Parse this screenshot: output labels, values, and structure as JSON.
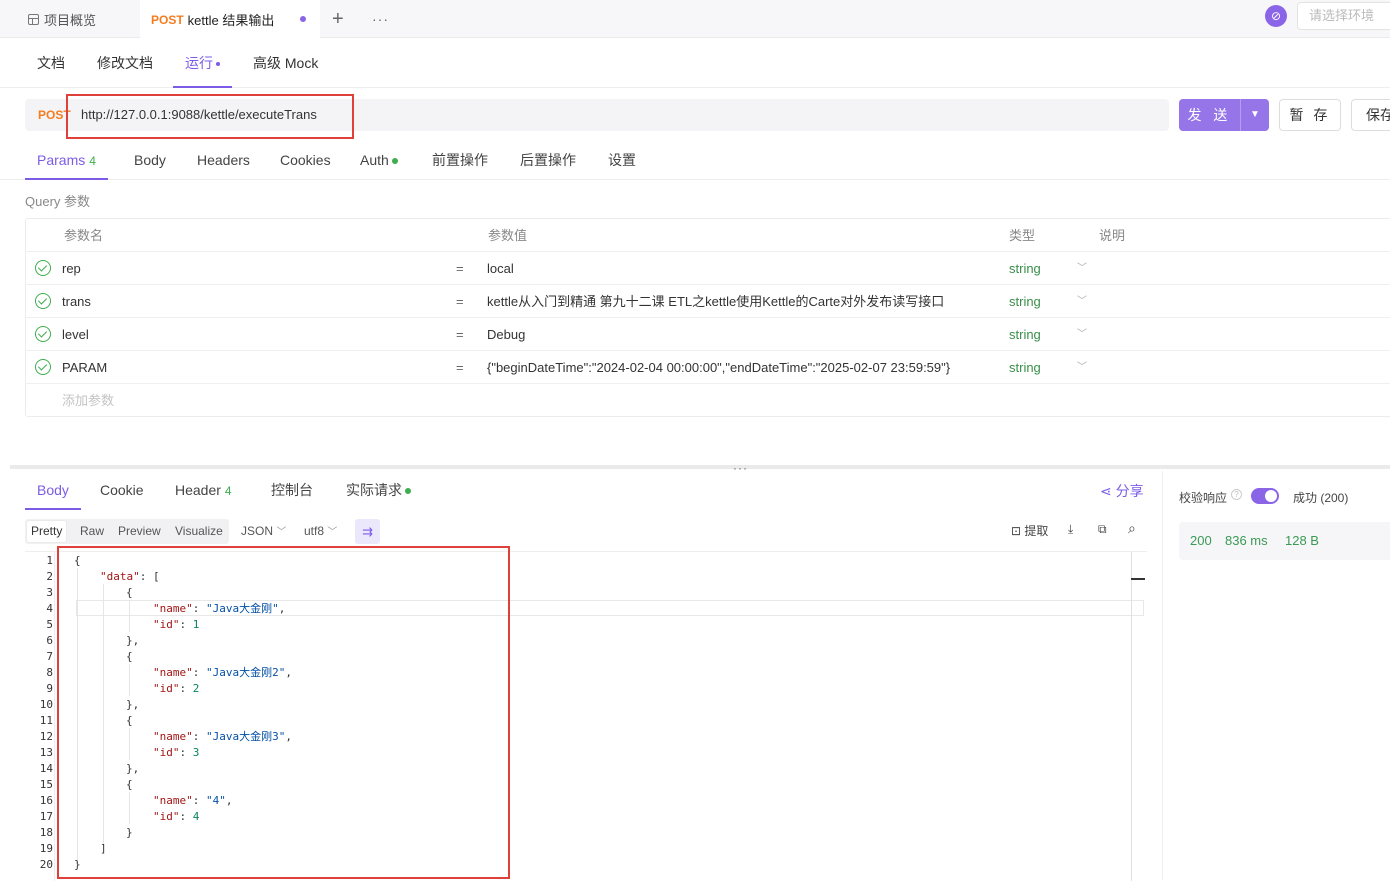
{
  "top_tabs": {
    "overview_label": "项目概览",
    "active_method": "POST",
    "active_title": "kettle 结果输出",
    "plus": "+",
    "more": "···",
    "env_placeholder": "请选择环境"
  },
  "doc_tabs": [
    "文档",
    "修改文档",
    "运行",
    "高级 Mock"
  ],
  "request": {
    "method": "POST",
    "url": "http://127.0.0.1:9088/kettle/executeTrans",
    "send_label": "发 送",
    "temp_save_label": "暂 存",
    "save_label": "保存"
  },
  "param_tabs": {
    "params": "Params",
    "params_count": "4",
    "body": "Body",
    "headers": "Headers",
    "cookies": "Cookies",
    "auth": "Auth",
    "pre": "前置操作",
    "post": "后置操作",
    "settings": "设置"
  },
  "query_label": "Query 参数",
  "params_table": {
    "headers": {
      "name": "参数名",
      "value": "参数值",
      "type": "类型",
      "desc": "说明"
    },
    "rows": [
      {
        "name": "rep",
        "value": "local",
        "type": "string"
      },
      {
        "name": "trans",
        "value": "kettle从入门到精通 第九十二课 ETL之kettle使用Kettle的Carte对外发布读写接口",
        "type": "string"
      },
      {
        "name": "level",
        "value": "Debug",
        "type": "string"
      },
      {
        "name": "PARAM",
        "value": "{\"beginDateTime\":\"2024-02-04 00:00:00\",\"endDateTime\":\"2025-02-07 23:59:59\"}",
        "type": "string"
      }
    ],
    "equals": "=",
    "add_placeholder": "添加参数"
  },
  "split_dots": "···",
  "response_tabs": {
    "body": "Body",
    "cookie": "Cookie",
    "header": "Header",
    "header_count": "4",
    "console": "控制台",
    "actual": "实际请求",
    "share": "分享"
  },
  "response_toolbar": {
    "modes": [
      "Pretty",
      "Raw",
      "Preview",
      "Visualize"
    ],
    "format": "JSON",
    "encoding": "utf8",
    "extract": "提取"
  },
  "validation": {
    "label": "校验响应",
    "status": "成功 (200)"
  },
  "stats": {
    "status": "200",
    "time": "836 ms",
    "size": "128 B"
  },
  "code": {
    "line_numbers": [
      "1",
      "2",
      "3",
      "4",
      "5",
      "6",
      "7",
      "8",
      "9",
      "10",
      "11",
      "12",
      "13",
      "14",
      "15",
      "16",
      "17",
      "18",
      "19",
      "20"
    ],
    "data_key": "\"data\"",
    "items": [
      {
        "name": "\"Java大金刚\"",
        "id": "1"
      },
      {
        "name": "\"Java大金刚2\"",
        "id": "2"
      },
      {
        "name": "\"Java大金刚3\"",
        "id": "3"
      },
      {
        "name": "\"4\"",
        "id": "4"
      }
    ],
    "name_key": "\"name\"",
    "id_key": "\"id\""
  },
  "colors": {
    "accent": "#7c5ce6",
    "method": "#f57c1f",
    "success": "#3cae4c",
    "highlight_box": "#e0403a"
  }
}
